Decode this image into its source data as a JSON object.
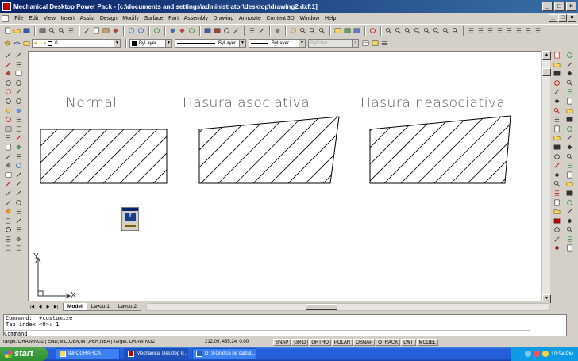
{
  "window": {
    "title": "Mechanical Desktop Power Pack - [c:\\documents and settings\\administrator\\desktop\\drawing2.dxf:1]",
    "minimize": "_",
    "maximize": "□",
    "close": "×"
  },
  "menu": [
    "File",
    "Edit",
    "View",
    "Insert",
    "Assist",
    "Design",
    "Modify",
    "Surface",
    "Part",
    "Assembly",
    "Drawing",
    "Annotate",
    "Content 3D",
    "Window",
    "Help"
  ],
  "layers": {
    "layer_value": "0",
    "color_value": "ByLayer",
    "linetype_value": "ByLayer",
    "lineweight_value": "ByLayer",
    "plotstyle_value": "ByColor"
  },
  "drawing": {
    "labels": [
      "Normal",
      "Hasura asociativa",
      "Hasura neasociativa"
    ],
    "ucs_x": "X",
    "ucs_y": "Y"
  },
  "float_toolbar": {
    "label": "TEXT"
  },
  "tabs": [
    "Model",
    "Layout1",
    "Layout2"
  ],
  "command": {
    "line1": "Command: _+customize",
    "line2": "Tab index <0>: 1",
    "line3": "Command:"
  },
  "status": {
    "osnap_string": "Target: DRAWING2 | END,MID,CEN,INT,PER,NEA | Target: DRAWING2",
    "coords": "212.09, 435.24, 0.00",
    "buttons": [
      "SNAP",
      "GRID",
      "ORTHO",
      "POLAR",
      "OSNAP",
      "OTRACK",
      "LWT",
      "MODEL"
    ]
  },
  "taskbar": {
    "start": "start",
    "items": [
      "INFOGRAFICA",
      "Mechanical Desktop P...",
      "DT3-Grafica pe calcul..."
    ],
    "clock": "10:54 PM"
  },
  "colors": {
    "titlebar": "#0a246a",
    "taskbar": "#245edb",
    "start": "#3a9a3a",
    "hatch": "#000000"
  }
}
